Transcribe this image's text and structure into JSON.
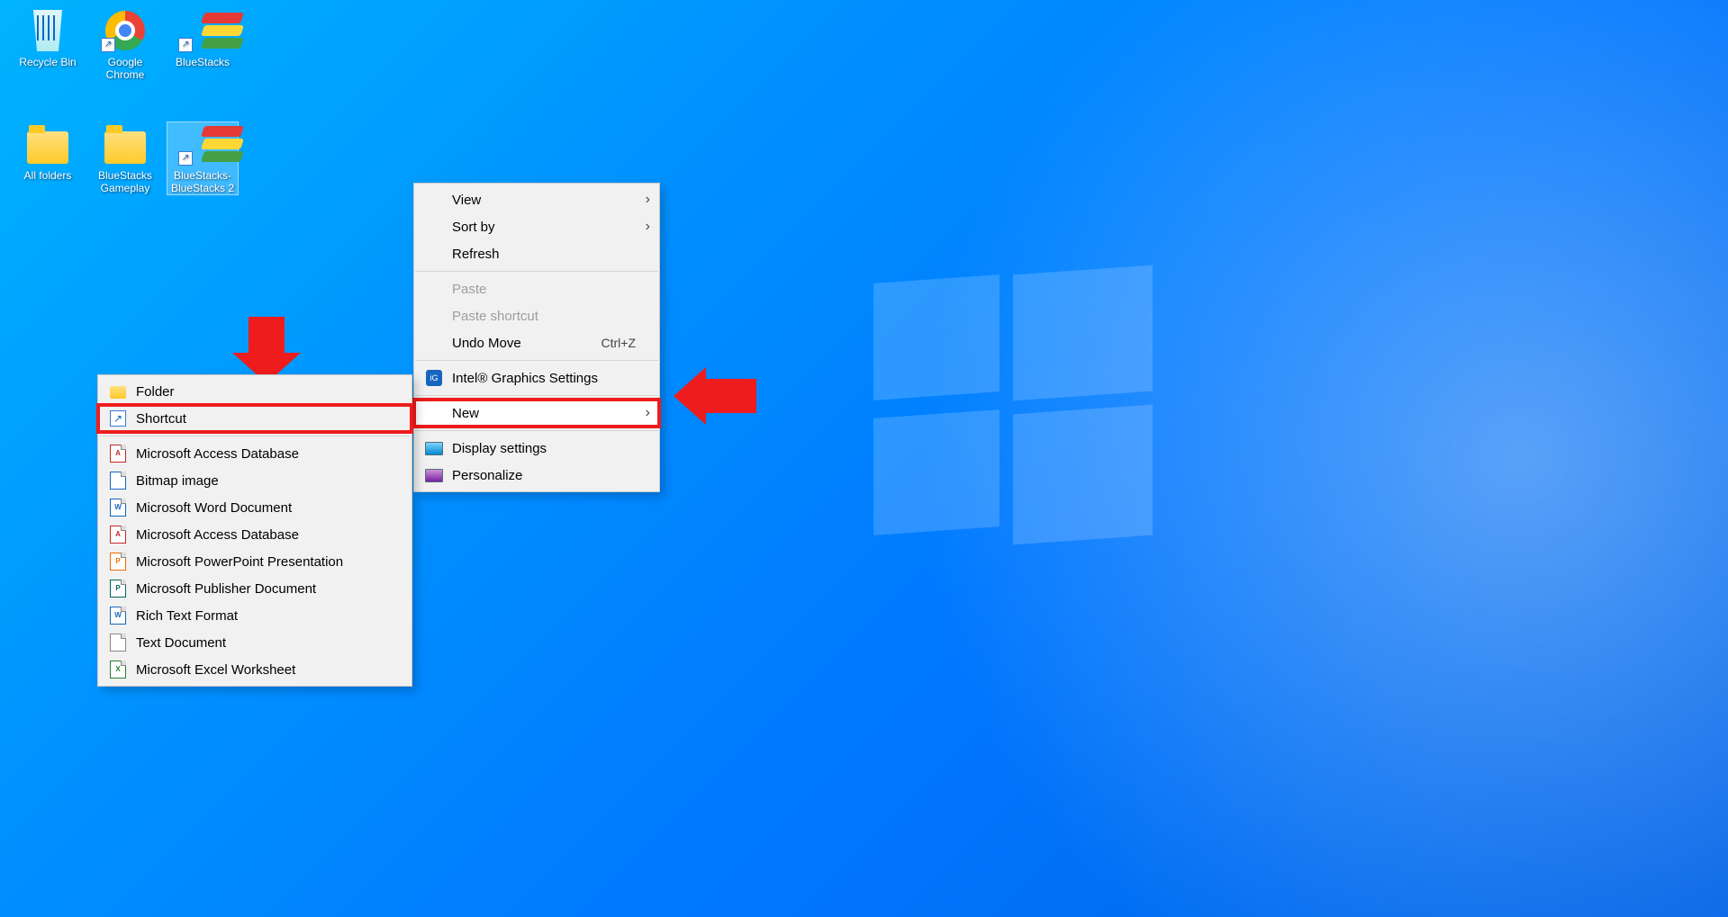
{
  "desktop_icons": [
    {
      "label": "Recycle Bin"
    },
    {
      "label": "Google Chrome"
    },
    {
      "label": "BlueStacks"
    },
    {
      "label": "All folders"
    },
    {
      "label": "BlueStacks Gameplay"
    },
    {
      "label": "BlueStacks-BlueStacks 2"
    }
  ],
  "context_menu": {
    "view": "View",
    "sort_by": "Sort by",
    "refresh": "Refresh",
    "paste": "Paste",
    "paste_shortcut": "Paste shortcut",
    "undo_move": "Undo Move",
    "undo_accel": "Ctrl+Z",
    "graphics": "Intel® Graphics Settings",
    "new": "New",
    "display": "Display settings",
    "personalize": "Personalize"
  },
  "new_submenu": [
    {
      "label": "Folder",
      "icon": "folder"
    },
    {
      "label": "Shortcut",
      "icon": "shortcut"
    },
    {
      "label": "Microsoft Access Database",
      "icon": "A",
      "cls": "red"
    },
    {
      "label": "Bitmap image",
      "icon": "",
      "cls": "blue"
    },
    {
      "label": "Microsoft Word Document",
      "icon": "W",
      "cls": "blue"
    },
    {
      "label": "Microsoft Access Database",
      "icon": "A",
      "cls": "red"
    },
    {
      "label": "Microsoft PowerPoint Presentation",
      "icon": "P",
      "cls": "orange"
    },
    {
      "label": "Microsoft Publisher Document",
      "icon": "P",
      "cls": "teal"
    },
    {
      "label": "Rich Text Format",
      "icon": "W",
      "cls": "blue"
    },
    {
      "label": "Text Document",
      "icon": "",
      "cls": ""
    },
    {
      "label": "Microsoft Excel Worksheet",
      "icon": "X",
      "cls": "green"
    }
  ]
}
